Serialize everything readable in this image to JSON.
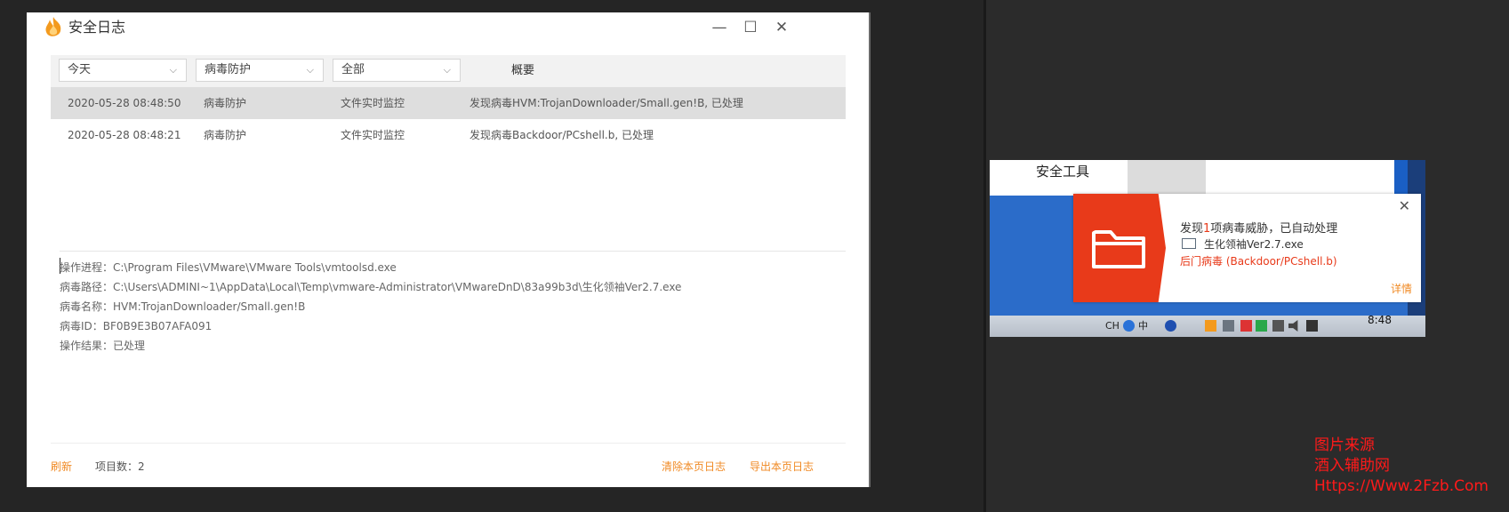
{
  "window": {
    "title": "安全日志",
    "controls": {
      "minimize": "—",
      "maximize": "☐",
      "close": "✕"
    }
  },
  "filters": {
    "date": "今天",
    "category": "病毒防护",
    "type": "全部",
    "summary_header": "概要"
  },
  "log_rows": [
    {
      "time": "2020-05-28 08:48:50",
      "category": "病毒防护",
      "source": "文件实时监控",
      "summary": "发现病毒HVM:TrojanDownloader/Small.gen!B, 已处理",
      "selected": true
    },
    {
      "time": "2020-05-28 08:48:21",
      "category": "病毒防护",
      "source": "文件实时监控",
      "summary": "发现病毒Backdoor/PCshell.b, 已处理",
      "selected": false
    }
  ],
  "details": [
    "操作进程：C:\\Program Files\\VMware\\VMware Tools\\vmtoolsd.exe",
    "病毒路径：C:\\Users\\ADMINI~1\\AppData\\Local\\Temp\\vmware-Administrator\\VMwareDnD\\83a99b3d\\生化领袖Ver2.7.exe",
    "病毒名称：HVM:TrojanDownloader/Small.gen!B",
    "病毒ID：BF0B9E3B07AFA091",
    "操作结果：已处理"
  ],
  "footer": {
    "refresh": "刷新",
    "item_count": "项目数：2",
    "clear": "清除本页日志",
    "export": "导出本页日志"
  },
  "snippet": {
    "window_title": "安全工具",
    "toast": {
      "line1_prefix": "发现",
      "line1_count": "1",
      "line1_suffix": "项病毒威胁，已自动处理",
      "file_name": "生化领袖Ver2.7.exe",
      "threat": "后门病毒 (Backdoor/PCshell.b)",
      "details_link": "详情",
      "close": "✕"
    },
    "taskbar": {
      "lang": "CH",
      "ime": "中",
      "time": "8:48"
    }
  },
  "watermark": [
    "图片来源",
    "酒入辅助网",
    "Https://Www.2Fzb.Com"
  ],
  "colors": {
    "accent_orange": "#f08a24",
    "threat_red": "#e83a1a",
    "selected_row": "#dedede"
  }
}
